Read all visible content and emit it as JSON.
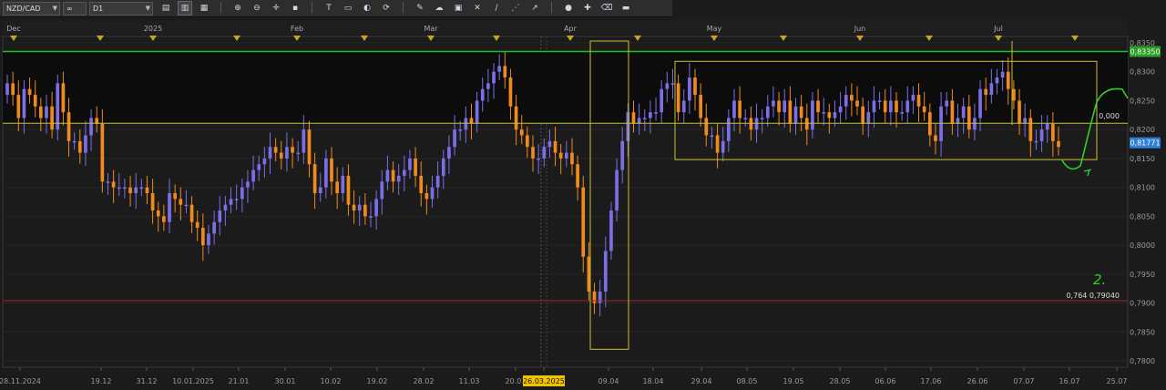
{
  "toolbar": {
    "symbol": "NZD/CAD",
    "compare_label": "∞",
    "timeframe": "D1",
    "buttons": [
      {
        "name": "chart-type-icon",
        "glyph": "▤"
      },
      {
        "name": "bar-chart-icon",
        "glyph": "▥",
        "active": true
      },
      {
        "name": "candle-chart-icon",
        "glyph": "▦"
      },
      {
        "name": "zoom-in-icon",
        "glyph": "⊕"
      },
      {
        "name": "zoom-out-icon",
        "glyph": "⊖"
      },
      {
        "name": "crosshair-icon",
        "glyph": "✛"
      },
      {
        "name": "pointer-icon",
        "glyph": "▪"
      },
      {
        "name": "text-tool-icon",
        "glyph": "T"
      },
      {
        "name": "note-icon",
        "glyph": "▭"
      },
      {
        "name": "shapes-icon",
        "glyph": "◐"
      },
      {
        "name": "refresh-icon",
        "glyph": "⟳"
      },
      {
        "name": "pencil-icon",
        "glyph": "✎"
      },
      {
        "name": "indicators-icon",
        "glyph": "☁"
      },
      {
        "name": "grid-icon",
        "glyph": "▣"
      },
      {
        "name": "cross-lines-icon",
        "glyph": "✕"
      },
      {
        "name": "channel-icon",
        "glyph": "∕"
      },
      {
        "name": "fib-icon",
        "glyph": "⋰"
      },
      {
        "name": "arrow-icon",
        "glyph": "↗"
      },
      {
        "name": "circle-icon",
        "glyph": "●"
      },
      {
        "name": "plus-icon",
        "glyph": "✚"
      },
      {
        "name": "eraser-icon",
        "glyph": "⌫"
      },
      {
        "name": "battery-icon",
        "glyph": "▬"
      }
    ]
  },
  "colors": {
    "background": "#1b1b1b",
    "bull": "#7b6fe8",
    "bear": "#f08a1c",
    "green_line": "#22c01c",
    "red_line": "#a02424",
    "yellow": "#c9c035",
    "price_tag_bg": "#2f7fd6",
    "green_tag_bg": "#2e9c2a",
    "event_marker": "#c8a51c"
  },
  "chart_data": {
    "type": "candlestick",
    "symbol": "NZD/CAD",
    "timeframe": "D1",
    "x_range": [
      "2024-11-28",
      "2025-07-25"
    ],
    "ylim": [
      0.78,
      0.835
    ],
    "grid": true,
    "y_ticks": [
      "0,8350",
      "0,8300",
      "0,8250",
      "0,8200",
      "0,8150",
      "0,8100",
      "0,8050",
      "0,8000",
      "0,7950",
      "0,7900",
      "0,7850",
      "0,7800"
    ],
    "x_ticks": [
      "28.11.2024",
      "19.12",
      "31.12",
      "10.01.2025",
      "21.01",
      "30.01",
      "10.02",
      "19.02",
      "28.02",
      "11.03",
      "20.03",
      "26.03.2025",
      "09.04",
      "18.04",
      "29.04",
      "08.05",
      "19.05",
      "28.05",
      "06.06",
      "17.06",
      "26.06",
      "07.07",
      "16.07",
      "25.07"
    ],
    "x_ticks_highlight": "26.03.2025",
    "month_labels": [
      "Dec",
      "2025",
      "Feb",
      "Mar",
      "Apr",
      "May",
      "Jun",
      "Jul"
    ],
    "current_price": "0,81771",
    "green_level": {
      "value": 0.8335,
      "label": "0,83350"
    },
    "red_level": {
      "value": 0.7904,
      "label": "0,764 0,79040"
    },
    "yellow_level": {
      "value": 0.8211,
      "label": "0,000"
    },
    "handwritten_label": "2.",
    "closes": [
      0.828,
      0.826,
      0.822,
      0.827,
      0.826,
      0.824,
      0.822,
      0.824,
      0.82,
      0.828,
      0.823,
      0.818,
      0.818,
      0.816,
      0.819,
      0.822,
      0.821,
      0.811,
      0.811,
      0.81,
      0.81,
      0.81,
      0.809,
      0.81,
      0.81,
      0.809,
      0.806,
      0.805,
      0.804,
      0.809,
      0.808,
      0.807,
      0.807,
      0.804,
      0.803,
      0.8,
      0.802,
      0.804,
      0.806,
      0.807,
      0.808,
      0.808,
      0.81,
      0.811,
      0.813,
      0.814,
      0.815,
      0.817,
      0.816,
      0.815,
      0.817,
      0.816,
      0.816,
      0.82,
      0.814,
      0.809,
      0.81,
      0.815,
      0.811,
      0.809,
      0.812,
      0.807,
      0.806,
      0.807,
      0.805,
      0.805,
      0.808,
      0.811,
      0.813,
      0.811,
      0.812,
      0.813,
      0.815,
      0.812,
      0.809,
      0.808,
      0.81,
      0.812,
      0.815,
      0.817,
      0.82,
      0.82,
      0.822,
      0.821,
      0.825,
      0.827,
      0.828,
      0.83,
      0.831,
      0.829,
      0.824,
      0.82,
      0.819,
      0.817,
      0.815,
      0.815,
      0.817,
      0.818,
      0.816,
      0.815,
      0.816,
      0.814,
      0.81,
      0.798,
      0.792,
      0.79,
      0.792,
      0.799,
      0.806,
      0.813,
      0.818,
      0.823,
      0.821,
      0.822,
      0.822,
      0.823,
      0.823,
      0.827,
      0.828,
      0.828,
      0.823,
      0.825,
      0.829,
      0.826,
      0.822,
      0.819,
      0.819,
      0.816,
      0.818,
      0.822,
      0.825,
      0.822,
      0.822,
      0.82,
      0.822,
      0.822,
      0.824,
      0.825,
      0.823,
      0.825,
      0.821,
      0.824,
      0.822,
      0.82,
      0.825,
      0.823,
      0.823,
      0.822,
      0.823,
      0.824,
      0.826,
      0.825,
      0.824,
      0.821,
      0.823,
      0.825,
      0.825,
      0.823,
      0.825,
      0.823,
      0.823,
      0.825,
      0.826,
      0.824,
      0.823,
      0.819,
      0.818,
      0.824,
      0.825,
      0.821,
      0.822,
      0.824,
      0.82,
      0.822,
      0.827,
      0.826,
      0.828,
      0.829,
      0.83,
      0.827,
      0.825,
      0.821,
      0.822,
      0.818,
      0.818,
      0.82,
      0.821,
      0.818,
      0.817
    ]
  }
}
